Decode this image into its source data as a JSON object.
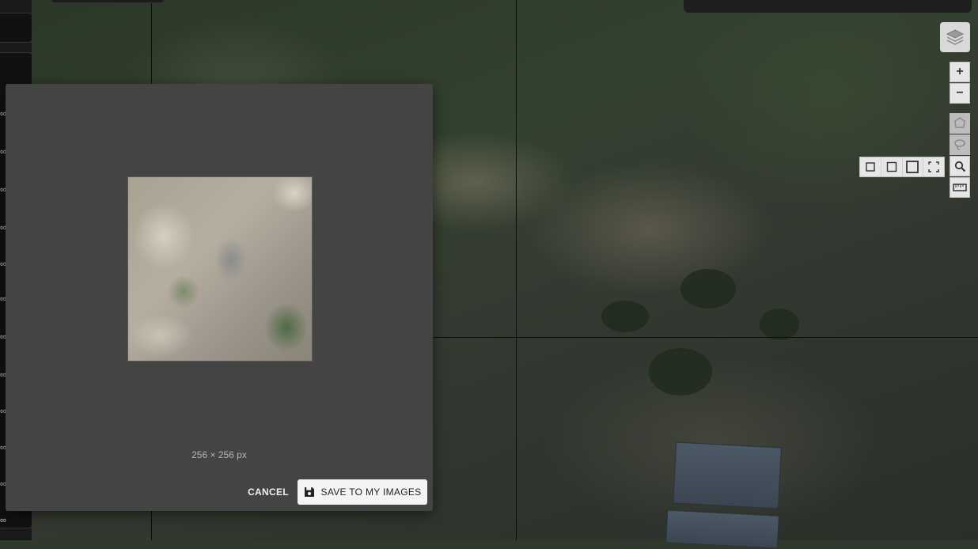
{
  "dialog": {
    "image_size": "256 × 256 px",
    "cancel_label": "CANCEL",
    "save_label": "SAVE TO MY IMAGES",
    "save_icon": "floppy-disk-icon"
  },
  "map_controls": {
    "zoom_in": "+",
    "zoom_out": "−",
    "layers_icon": "layers-icon",
    "polygon_icon": "polygon-icon",
    "lasso_icon": "lasso-icon",
    "search_icon": "search-icon",
    "ruler_icon": "ruler-icon",
    "shape_icons": [
      "square-small-icon",
      "square-medium-icon",
      "square-large-icon",
      "fullscreen-frame-icon"
    ]
  },
  "colors": {
    "dialog_bg": "#444444",
    "save_button_bg": "#f4f4f4",
    "tool_bg": "#e6e6e6"
  }
}
